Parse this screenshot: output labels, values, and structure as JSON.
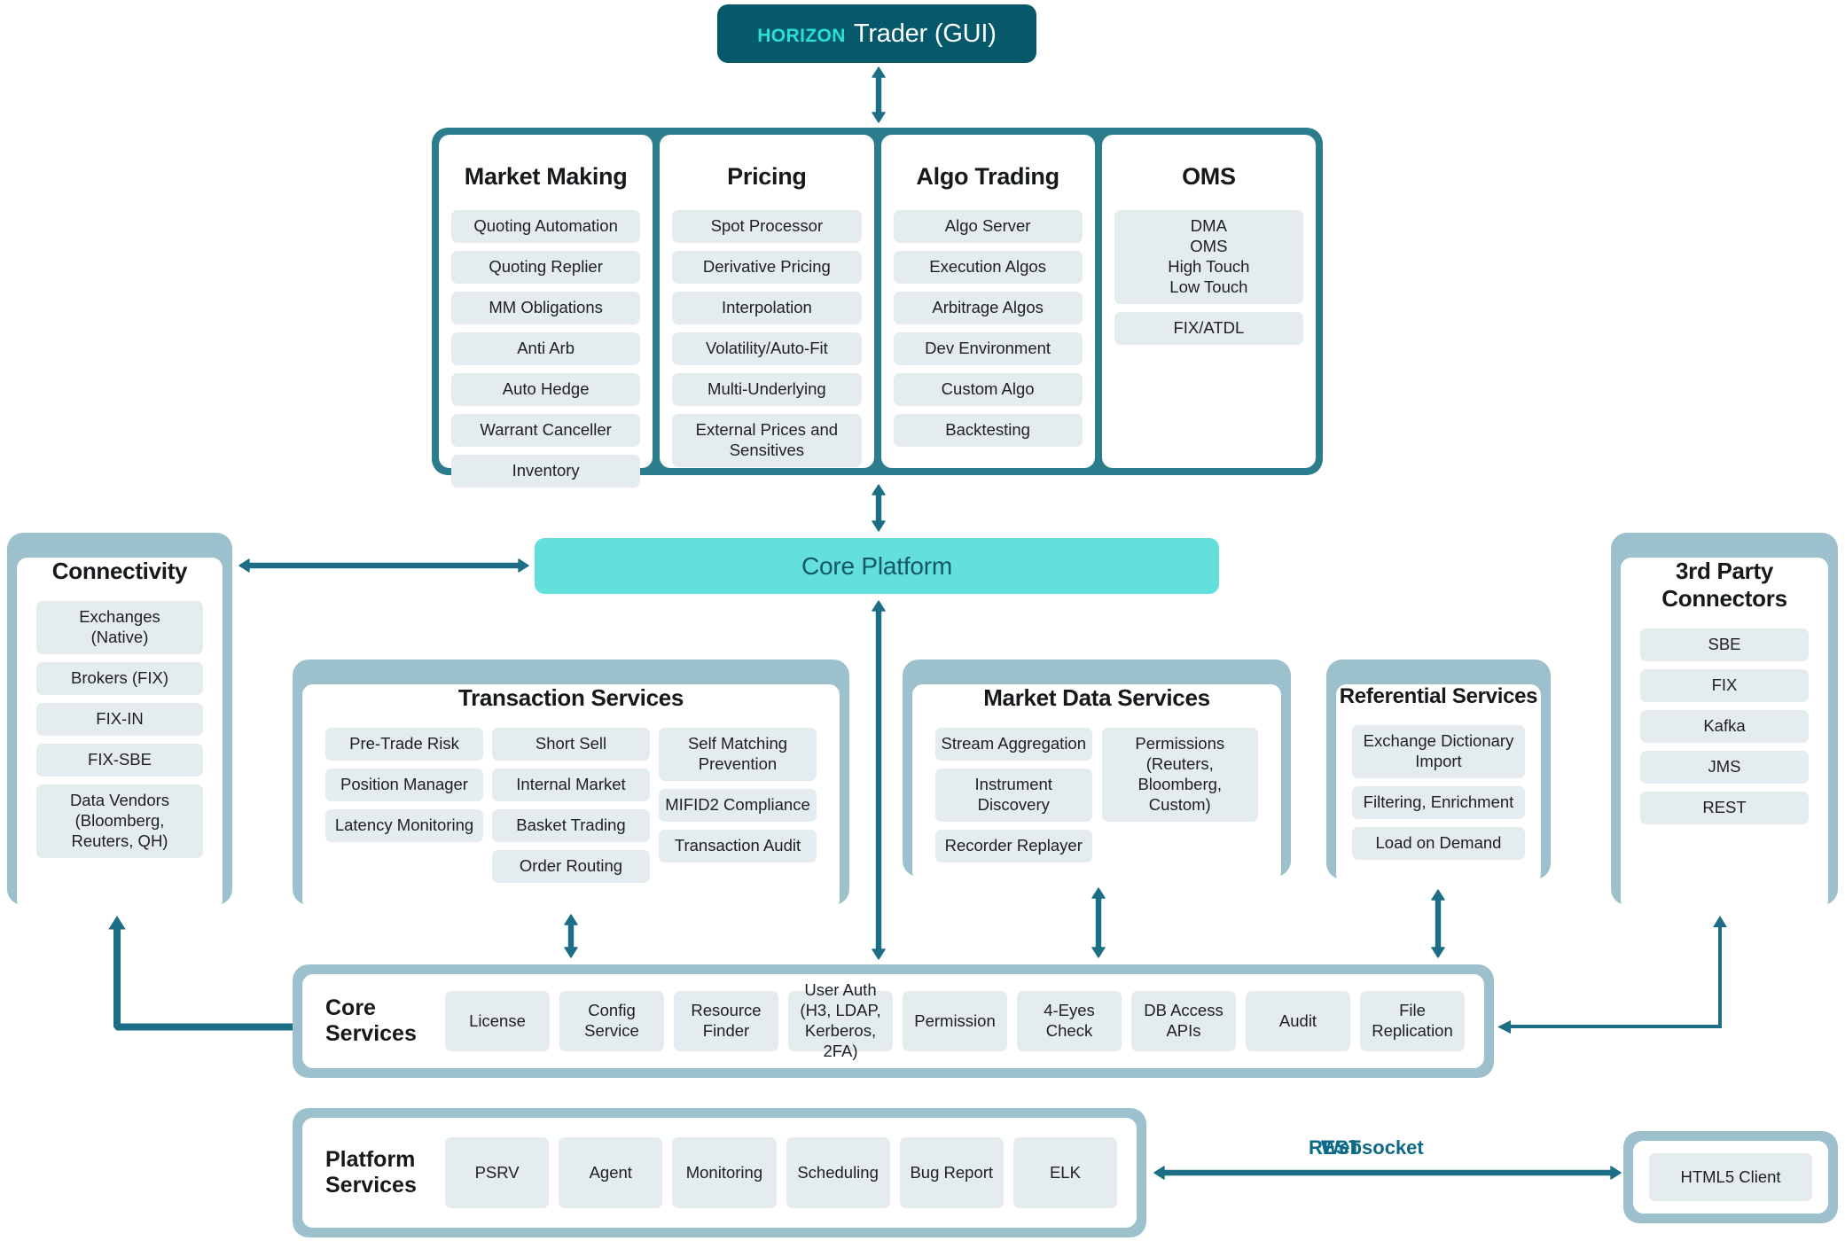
{
  "header": {
    "brand": "horizon",
    "subtitle": "Trader (GUI)"
  },
  "colors": {
    "header_bg": "#05596b",
    "brand_text": "#2ae0d4",
    "panel_dark_border": "#2b7c8c",
    "panel_light_border": "#9dc1cc",
    "chip_bg": "#e4ecf0",
    "core_platform_bg": "#63e0dc",
    "core_platform_text": "#12586c",
    "arrow": "#1c6e86"
  },
  "apps": {
    "columns": [
      {
        "title": "Market Making",
        "items": [
          "Quoting Automation",
          "Quoting Replier",
          "MM Obligations",
          "Anti Arb",
          "Auto Hedge",
          "Warrant Canceller",
          "Inventory"
        ]
      },
      {
        "title": "Pricing",
        "items": [
          "Spot Processor",
          "Derivative Pricing",
          "Interpolation",
          "Volatility/Auto-Fit",
          "Multi-Underlying",
          "External Prices and\nSensitives"
        ]
      },
      {
        "title": "Algo Trading",
        "items": [
          "Algo Server",
          "Execution Algos",
          "Arbitrage Algos",
          "Dev Environment",
          "Custom Algo",
          "Backtesting"
        ]
      },
      {
        "title": "OMS",
        "items": [
          "DMA\nOMS\nHigh Touch\nLow Touch",
          "FIX/ATDL"
        ]
      }
    ]
  },
  "core_platform": {
    "label": "Core Platform"
  },
  "connectivity": {
    "title": "Connectivity",
    "items": [
      "Exchanges\n(Native)",
      "Brokers (FIX)",
      "FIX-IN",
      "FIX-SBE",
      "Data Vendors\n(Bloomberg,\nReuters, QH)"
    ]
  },
  "third_party": {
    "title": "3rd Party Connectors",
    "items": [
      "SBE",
      "FIX",
      "Kafka",
      "JMS",
      "REST"
    ]
  },
  "transaction_services": {
    "title": "Transaction Services",
    "columns": [
      [
        "Pre-Trade Risk",
        "Position Manager",
        "Latency Monitoring"
      ],
      [
        "Short Sell",
        "Internal Market",
        "Basket Trading",
        "Order Routing"
      ],
      [
        "Self Matching\nPrevention",
        "MIFID2 Compliance",
        "Transaction Audit"
      ]
    ]
  },
  "market_data_services": {
    "title": "Market Data Services",
    "columns": [
      [
        "Stream Aggregation",
        "Instrument Discovery",
        "Recorder Replayer"
      ],
      [
        "Permissions\n(Reuters, Bloomberg,\nCustom)"
      ]
    ]
  },
  "referential_services": {
    "title": "Referential Services",
    "items": [
      "Exchange Dictionary\nImport",
      "Filtering, Enrichment",
      "Load on Demand"
    ]
  },
  "core_services": {
    "label": "Core\nServices",
    "items": [
      "License",
      "Config Service",
      "Resource\nFinder",
      "User Auth\n(H3, LDAP,\nKerberos, 2FA)",
      "Permission",
      "4-Eyes Check",
      "DB Access\nAPIs",
      "Audit",
      "File Replication"
    ]
  },
  "platform_services": {
    "label": "Platform\nServices",
    "items": [
      "PSRV",
      "Agent",
      "Monitoring",
      "Scheduling",
      "Bug Report",
      "ELK"
    ]
  },
  "html5_client": {
    "label": "HTML5 Client"
  },
  "connector_labels": {
    "rest": "REST",
    "websocket": "Websocket"
  }
}
